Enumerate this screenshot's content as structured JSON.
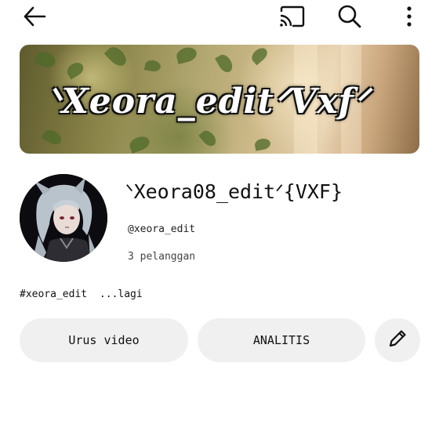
{
  "topbar": {
    "icons": [
      "back-arrow-icon",
      "cast-icon",
      "search-icon",
      "more-vertical-icon"
    ]
  },
  "banner": {
    "text": "ᐠXeora_editᐟVxfᐟ"
  },
  "profile": {
    "channel_name": "ᐠXeora08_editᐟ{VXF}",
    "handle": "@xeora_edit",
    "subscribers": "3 pelanggan",
    "hashtag": "#xeora_edit",
    "more_label": "...lagi"
  },
  "actions": {
    "manage_videos_label": "Urus video",
    "analytics_label": "ANALITIS",
    "edit_icon": "pencil-icon"
  },
  "colors": {
    "pill_bg": "#f0f0f0",
    "text": "#0f0f0f",
    "background": "#ffffff"
  }
}
